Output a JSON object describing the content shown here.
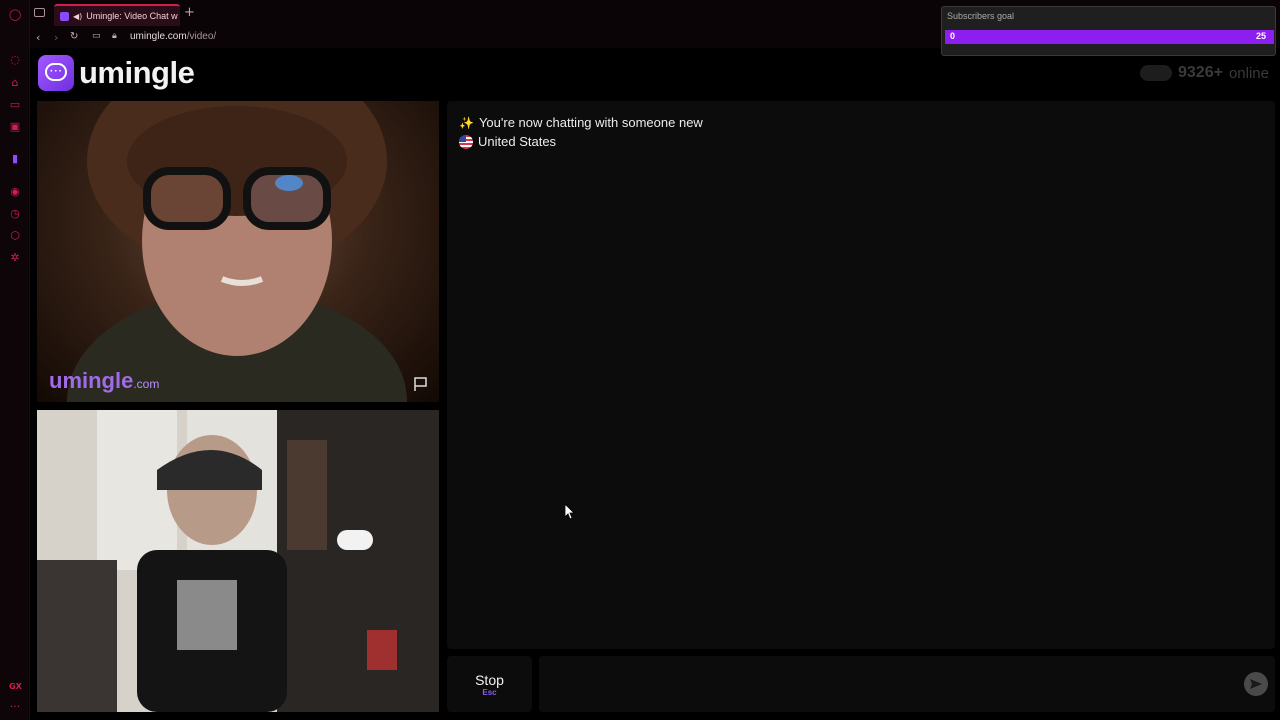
{
  "browser": {
    "tab_title": "Umingle: Video Chat w",
    "address": {
      "domain": "umingle.com",
      "path": "/video/"
    },
    "sidebar_icons": [
      "opera-icon",
      "aria-icon",
      "kiosk-icon",
      "messenger-icon",
      "news-icon",
      "twitch-icon",
      "player-icon",
      "history-icon",
      "extensions-icon",
      "settings-icon",
      "gx-icon",
      "more-icon"
    ],
    "gx_label": "GX",
    "more_label": "···"
  },
  "subscribers_goal": {
    "label": "Subscribers goal",
    "start": "0",
    "goal": "25",
    "progress": 1.0,
    "fill_color": "#8c1ff0"
  },
  "site": {
    "logo_text": "umingle",
    "online_count": "9326+",
    "online_word": "online"
  },
  "video": {
    "watermark_brand": "umingle",
    "watermark_tld": ".com"
  },
  "chat": {
    "status_emoji": "✨",
    "status_text": "You're now chatting with someone new",
    "country": "United States"
  },
  "controls": {
    "stop_label": "Stop",
    "stop_key": "Esc",
    "input_placeholder": ""
  },
  "colors": {
    "accent": "#8a5cf0",
    "gx_red": "#d21e4a"
  }
}
